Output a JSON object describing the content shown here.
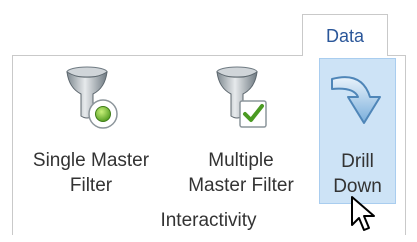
{
  "ribbon": {
    "active_tab": "Data",
    "group_label": "Interactivity",
    "commands": [
      {
        "line1": "Single Master",
        "line2": "Filter",
        "icon": "funnel-single-icon",
        "state": "normal"
      },
      {
        "line1": "Multiple",
        "line2": "Master Filter",
        "icon": "funnel-multiple-check-icon",
        "state": "normal"
      },
      {
        "line1": "Drill",
        "line2": "Down",
        "icon": "drill-down-arrow-icon",
        "state": "hover"
      }
    ]
  },
  "colors": {
    "tab_text": "#2b579a",
    "hover_fill": "#cde3f6",
    "hover_border": "#a9cdef",
    "border": "#c9c9c9",
    "text": "#333333"
  },
  "cursor": "arrow-pointer-icon"
}
